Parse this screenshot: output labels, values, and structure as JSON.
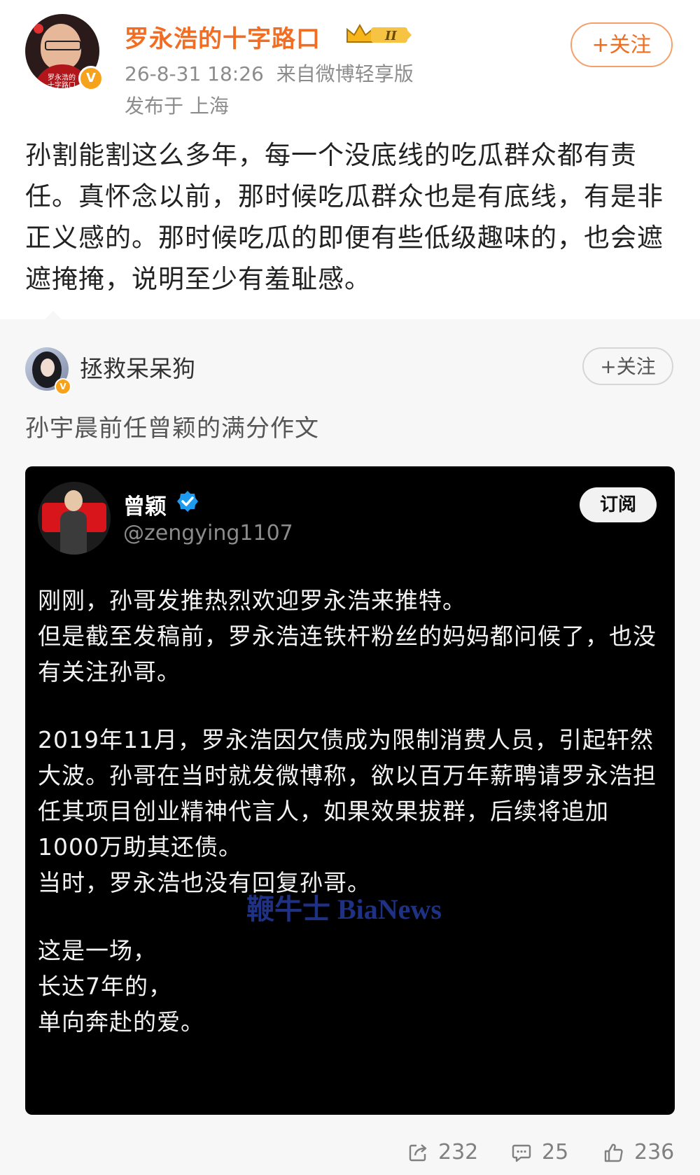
{
  "post": {
    "username": "罗永浩的十字路口",
    "level_badge": "II",
    "verified_badge": "V",
    "timestamp": "26-8-31 18:26",
    "source": "来自微博轻享版",
    "location": "发布于 上海",
    "follow_label": "+关注",
    "avatar_caption": "罗永浩的十字路口",
    "text": "孙割能割这么多年，每一个没底线的吃瓜群众都有责任。真怀念以前，那时候吃瓜群众也是有底线，有是非正义感的。那时候吃瓜的即便有些低级趣味的，也会遮遮掩掩，说明至少有羞耻感。"
  },
  "repost": {
    "username": "拯救呆呆狗",
    "follow_label": "+关注",
    "text": "孙宇晨前任曾颖的满分作文"
  },
  "tweet": {
    "name": "曾颖",
    "handle": "@zengying1107",
    "subscribe_label": "订阅",
    "paragraph1": [
      "刚刚，孙哥发推热烈欢迎罗永浩来推特。",
      "但是截至发稿前，罗永浩连铁杆粉丝的妈妈都问候了，也没有关注孙哥。"
    ],
    "paragraph2": [
      "2019年11月，罗永浩因欠债成为限制消费人员，引起轩然大波。孙哥在当时就发微博称，欲以百万年薪聘请罗永浩担任其项目创业精神代言人，如果效果拔群，后续将追加1000万助其还债。",
      "当时，罗永浩也没有回复孙哥。"
    ],
    "paragraph3": [
      "这是一场，",
      "长达7年的，",
      "单向奔赴的爱。"
    ],
    "watermark": "鞭牛士 BiaNews"
  },
  "actions": {
    "repost_count": "232",
    "comment_count": "25",
    "like_count": "236"
  },
  "colors": {
    "accent_orange": "#f26d21",
    "verified_blue": "#1d9bf0",
    "watermark_blue": "#243a9a"
  },
  "icons": [
    "repost-icon",
    "comment-icon",
    "like-icon",
    "verified-check-icon",
    "crown-icon"
  ]
}
